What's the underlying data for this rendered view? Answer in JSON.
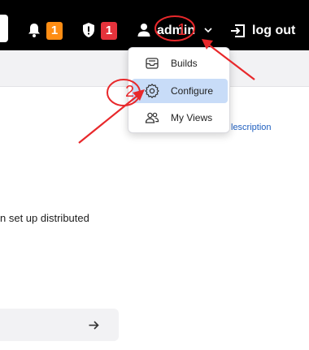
{
  "header": {
    "notifications_count": "1",
    "security_count": "1",
    "user_name": "admin",
    "logout_label": "log out"
  },
  "user_menu": {
    "items": [
      {
        "label": "Builds",
        "icon": "builds-inbox-icon"
      },
      {
        "label": "Configure",
        "icon": "gear-icon",
        "active": true
      },
      {
        "label": "My Views",
        "icon": "people-icon"
      }
    ]
  },
  "page": {
    "description_link": "lescription",
    "body_text": "n set up distributed"
  },
  "annotations": {
    "marker_1": "1",
    "marker_2": "2",
    "color": "#e8282b"
  },
  "colors": {
    "header_bg": "#000000",
    "badge_orange": "#fe8d14",
    "badge_red": "#e5323b",
    "active_menu_bg": "#c8dcf8",
    "link": "#1f5fbf"
  }
}
